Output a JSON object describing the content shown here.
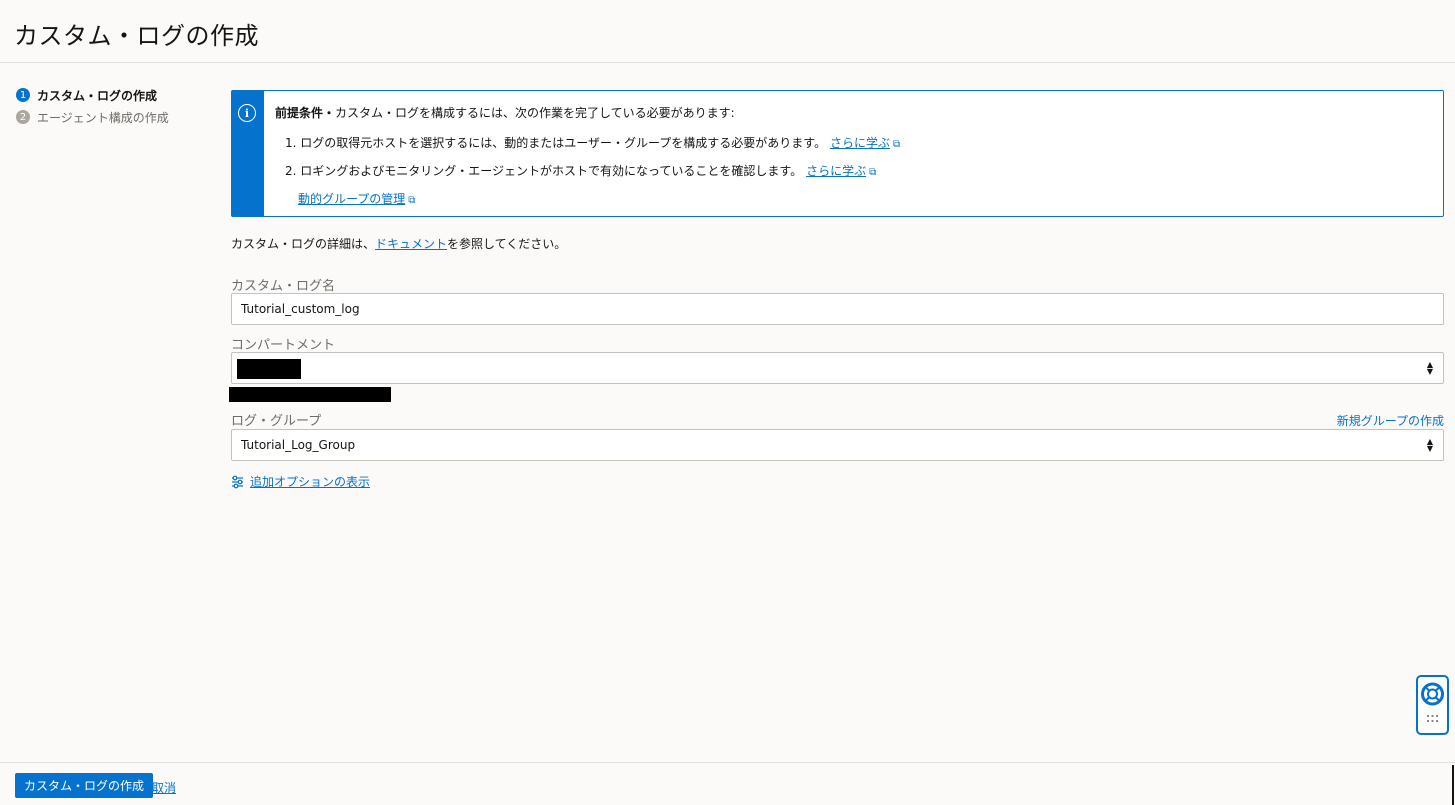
{
  "header": {
    "title": "カスタム・ログの作成"
  },
  "steps": [
    {
      "num": "1",
      "label": "カスタム・ログの作成",
      "active": true
    },
    {
      "num": "2",
      "label": "エージェント構成の作成",
      "active": false
    }
  ],
  "prereq": {
    "icon": "info-icon",
    "title_bold": "前提条件・",
    "title_rest": "カスタム・ログを構成するには、次の作業を完了している必要があります:",
    "item1_text": "1. ログの取得元ホストを選択するには、動的またはユーザー・グループを構成する必要があります。",
    "item1_link": "さらに学ぶ",
    "item2_text": "2. ロギングおよびモニタリング・エージェントがホストで有効になっていることを確認します。",
    "item2_link": "さらに学ぶ",
    "manage_link": "動的グループの管理"
  },
  "doc_line": {
    "prefix": "カスタム・ログの詳細は、",
    "link": "ドキュメント",
    "suffix": "を参照してください。"
  },
  "form": {
    "name_label": "カスタム・ログ名",
    "name_value": "Tutorial_custom_log",
    "compartment_label": "コンパートメント",
    "log_group_label": "ログ・グループ",
    "log_group_value": "Tutorial_Log_Group",
    "new_group_link": "新規グループの作成",
    "more_options": "追加オプションの表示"
  },
  "footer": {
    "primary_label": "カスタム・ログの作成",
    "cancel_label": "取消"
  },
  "colors": {
    "accent": "#0572ce",
    "background": "#fbfaf9",
    "border": "#c5c1bc"
  }
}
